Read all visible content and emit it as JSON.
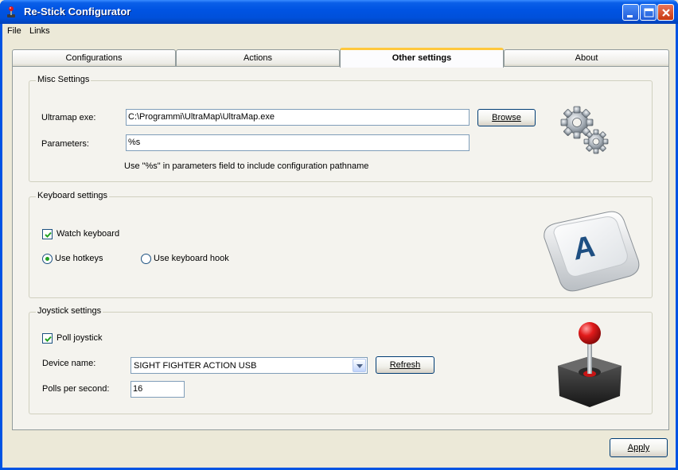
{
  "window": {
    "title": "Re-Stick Configurator"
  },
  "menu": {
    "items": [
      {
        "label": "File"
      },
      {
        "label": "Links"
      }
    ]
  },
  "tabs": [
    {
      "label": "Configurations",
      "active": false
    },
    {
      "label": "Actions",
      "active": false
    },
    {
      "label": "Other settings",
      "active": true
    },
    {
      "label": "About",
      "active": false
    }
  ],
  "misc": {
    "title": "Misc Settings",
    "ultramap_label": "Ultramap exe:",
    "ultramap_value": "C:\\Programmi\\UltraMap\\UltraMap.exe",
    "browse_label": "Browse",
    "parameters_label": "Parameters:",
    "parameters_value": "%s",
    "hint": "Use \"%s\" in parameters field to include configuration pathname",
    "icon": "gears-icon"
  },
  "keyboard": {
    "title": "Keyboard settings",
    "watch_label": "Watch keyboard",
    "watch_checked": true,
    "hotkeys_label": "Use hotkeys",
    "hotkeys_selected": true,
    "hook_label": "Use keyboard hook",
    "hook_selected": false,
    "icon": "keyboard-key-icon"
  },
  "joystick": {
    "title": "Joystick settings",
    "poll_label": "Poll joystick",
    "poll_checked": true,
    "device_label": "Device name:",
    "device_value": "SIGHT FIGHTER ACTION USB",
    "refresh_label": "Refresh",
    "polls_label": "Polls per second:",
    "polls_value": "16",
    "icon": "joystick-icon"
  },
  "footer": {
    "apply_label": "Apply"
  },
  "colors": {
    "titlebar": "#0054E3",
    "active_tab_accent": "#FFC83C",
    "close_button": "#C8380F"
  }
}
